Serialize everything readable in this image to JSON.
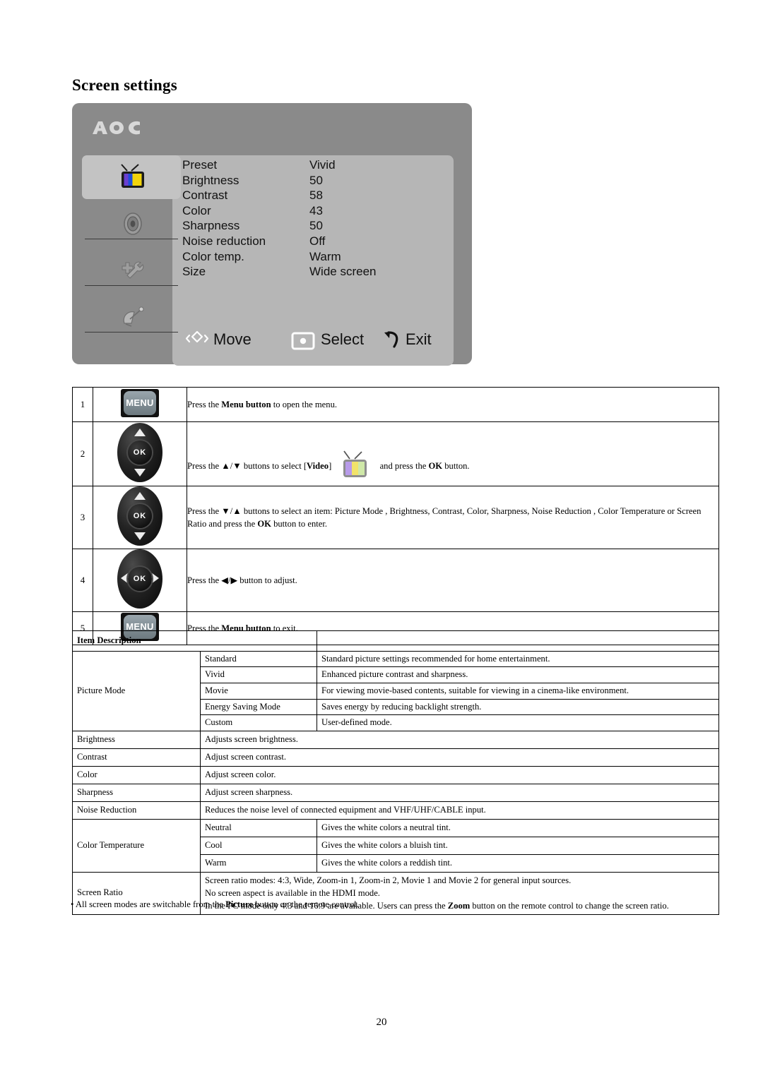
{
  "page": {
    "heading": "Screen settings",
    "page_number": "20",
    "footnote_prefix": "• All screen modes are switchable from the ",
    "footnote_bold": "Picture",
    "footnote_suffix": " button on the remote control."
  },
  "osd": {
    "brand": "AOC",
    "title": "Video",
    "title_color": "#2b2bdf",
    "panel_color": "#8a8a8a",
    "inner_color": "#b6b6b6",
    "sidebar": [
      {
        "icon": "tv-icon",
        "selected": true
      },
      {
        "icon": "speaker-icon",
        "selected": false
      },
      {
        "icon": "wrench-icon",
        "selected": false
      },
      {
        "icon": "satellite-dish-icon",
        "selected": false
      }
    ],
    "rows": [
      {
        "label": "Preset",
        "value": "Vivid"
      },
      {
        "label": "Brightness",
        "value": "50"
      },
      {
        "label": "Contrast",
        "value": "58"
      },
      {
        "label": "Color",
        "value": "43"
      },
      {
        "label": "Sharpness",
        "value": "50"
      },
      {
        "label": "Noise reduction",
        "value": "Off"
      },
      {
        "label": "Color temp.",
        "value": "Warm"
      },
      {
        "label": "Size",
        "value": "Wide screen"
      }
    ],
    "bar": [
      {
        "icon": "dpad-move-icon",
        "label": "Move"
      },
      {
        "icon": "select-dot-icon",
        "label": "Select"
      },
      {
        "icon": "exit-arrow-icon",
        "label": "Exit"
      }
    ]
  },
  "steps": [
    {
      "num": "1",
      "icon": "menu-button-icon",
      "icon_label": "MENU",
      "text_parts": [
        {
          "t": "Press the ",
          "b": false
        },
        {
          "t": "Menu button",
          "b": true
        },
        {
          "t": " to open the menu.",
          "b": false
        }
      ]
    },
    {
      "num": "2",
      "icon": "dpad-updown-icon",
      "icon_label": "OK",
      "text_parts": [
        {
          "t": "Press the  ▲/▼  buttons to select [",
          "b": false
        },
        {
          "t": "Video",
          "b": true
        },
        {
          "t": "] ",
          "b": false
        },
        {
          "t": "__TVICON__",
          "b": false
        },
        {
          "t": " and press the ",
          "b": false
        },
        {
          "t": "OK",
          "b": true
        },
        {
          "t": " button.",
          "b": false
        }
      ]
    },
    {
      "num": "3",
      "icon": "dpad-updown-icon",
      "icon_label": "OK",
      "text_parts": [
        {
          "t": "Press the  ▼/▲  buttons to select an item: Picture Mode , Brightness, Contrast, Color,    Sharpness,    Noise Reduction , Color Temperature or Screen Ratio and press the ",
          "b": false
        },
        {
          "t": "OK",
          "b": true
        },
        {
          "t": " button to enter.",
          "b": false
        }
      ]
    },
    {
      "num": "4",
      "icon": "dpad-leftright-icon",
      "icon_label": "OK",
      "text_parts": [
        {
          "t": "Press the  ◀/▶  button to adjust.",
          "b": false
        }
      ]
    },
    {
      "num": "5",
      "icon": "menu-button-icon",
      "icon_label": "MENU",
      "text_parts": [
        {
          "t": "Press the ",
          "b": false
        },
        {
          "t": "Menu button",
          "b": true
        },
        {
          "t": " to exit.",
          "b": false
        }
      ]
    }
  ],
  "item_table": {
    "header": "Item Description",
    "picture_mode": {
      "label": "Picture Mode",
      "modes": [
        {
          "name": "Standard",
          "desc": "Standard picture settings recommended for home entertainment."
        },
        {
          "name": "Vivid",
          "desc": "Enhanced picture contrast and sharpness."
        },
        {
          "name": "Movie",
          "desc": "For viewing movie-based contents, suitable for viewing in a cinema-like environment."
        },
        {
          "name": "Energy Saving Mode",
          "desc": "Saves energy by reducing backlight strength."
        },
        {
          "name": "Custom",
          "desc": "User-defined mode."
        }
      ]
    },
    "simple_rows": [
      {
        "label": "Brightness",
        "desc": "Adjusts screen brightness."
      },
      {
        "label": "Contrast",
        "desc": "Adjust screen contrast."
      },
      {
        "label": "Color",
        "desc": "Adjust screen color."
      },
      {
        "label": "Sharpness",
        "desc": "Adjust screen sharpness."
      },
      {
        "label": "Noise Reduction",
        "desc": "Reduces the noise level of connected equipment and VHF/UHF/CABLE input."
      }
    ],
    "color_temperature": {
      "label": "Color Temperature",
      "options": [
        {
          "name": "Neutral",
          "desc": "Gives the white colors a neutral tint."
        },
        {
          "name": "Cool",
          "desc": "Gives the white colors a bluish tint."
        },
        {
          "name": "Warm",
          "desc": "Gives the white colors a reddish tint."
        }
      ]
    },
    "screen_ratio": {
      "label": "Screen Ratio",
      "line1": "Screen ratio modes: 4:3, Wide, Zoom-in 1, Zoom-in 2, Movie 1 and Movie 2 for general input sources.",
      "line2": "No screen aspect is available in the HDMI mode.",
      "line3_a": "In the PC mode only 4:3 and 16:9 are available. Users can press the ",
      "line3_b": "Zoom",
      "line3_c": " button on the remote control to change the screen ratio."
    }
  }
}
